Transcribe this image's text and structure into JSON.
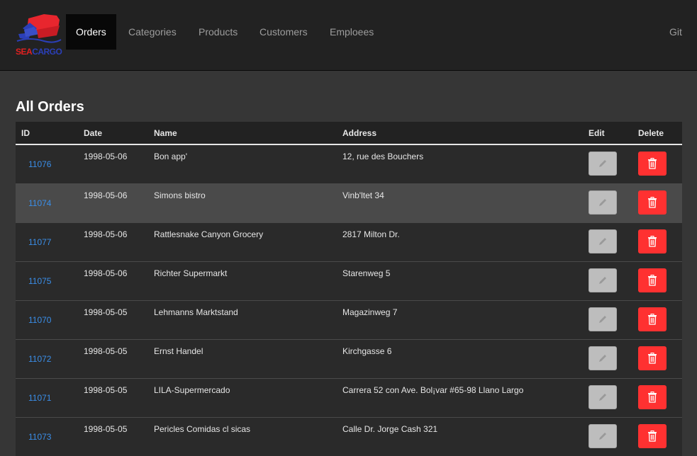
{
  "brand": {
    "logo_icon": "ship-icon",
    "logo_text_part1": "SEA",
    "logo_text_part2": "CARGO",
    "colors": {
      "sea": "#e02020",
      "cargo": "#2b3fb8"
    }
  },
  "nav": {
    "items": [
      {
        "label": "Orders",
        "active": true
      },
      {
        "label": "Categories",
        "active": false
      },
      {
        "label": "Products",
        "active": false
      },
      {
        "label": "Customers",
        "active": false
      },
      {
        "label": "Emploees",
        "active": false
      }
    ],
    "right_link": "Git"
  },
  "page": {
    "title": "All Orders"
  },
  "table": {
    "headers": {
      "id": "ID",
      "date": "Date",
      "name": "Name",
      "address": "Address",
      "edit": "Edit",
      "delete": "Delete"
    },
    "rows": [
      {
        "id": "11076",
        "date": "1998-05-06",
        "name": "Bon app'",
        "address": "12, rue des Bouchers"
      },
      {
        "id": "11074",
        "date": "1998-05-06",
        "name": "Simons bistro",
        "address": "Vinb'ltet 34"
      },
      {
        "id": "11077",
        "date": "1998-05-06",
        "name": "Rattlesnake Canyon Grocery",
        "address": "2817 Milton Dr."
      },
      {
        "id": "11075",
        "date": "1998-05-06",
        "name": "Richter Supermarkt",
        "address": "Starenweg 5"
      },
      {
        "id": "11070",
        "date": "1998-05-05",
        "name": "Lehmanns Marktstand",
        "address": "Magazinweg 7"
      },
      {
        "id": "11072",
        "date": "1998-05-05",
        "name": "Ernst Handel",
        "address": "Kirchgasse 6"
      },
      {
        "id": "11071",
        "date": "1998-05-05",
        "name": "LILA-Supermercado",
        "address": "Carrera 52 con Ave. Bol¡var #65-98 Llano Largo"
      },
      {
        "id": "11073",
        "date": "1998-05-05",
        "name": "Pericles Comidas cl sicas",
        "address": "Calle Dr. Jorge Cash 321"
      }
    ],
    "edit_icon": "pencil-icon",
    "delete_icon": "trash-icon",
    "colors": {
      "link": "#3a8ee8",
      "delete": "#ff3131",
      "edit": "#bdbdbd"
    }
  }
}
